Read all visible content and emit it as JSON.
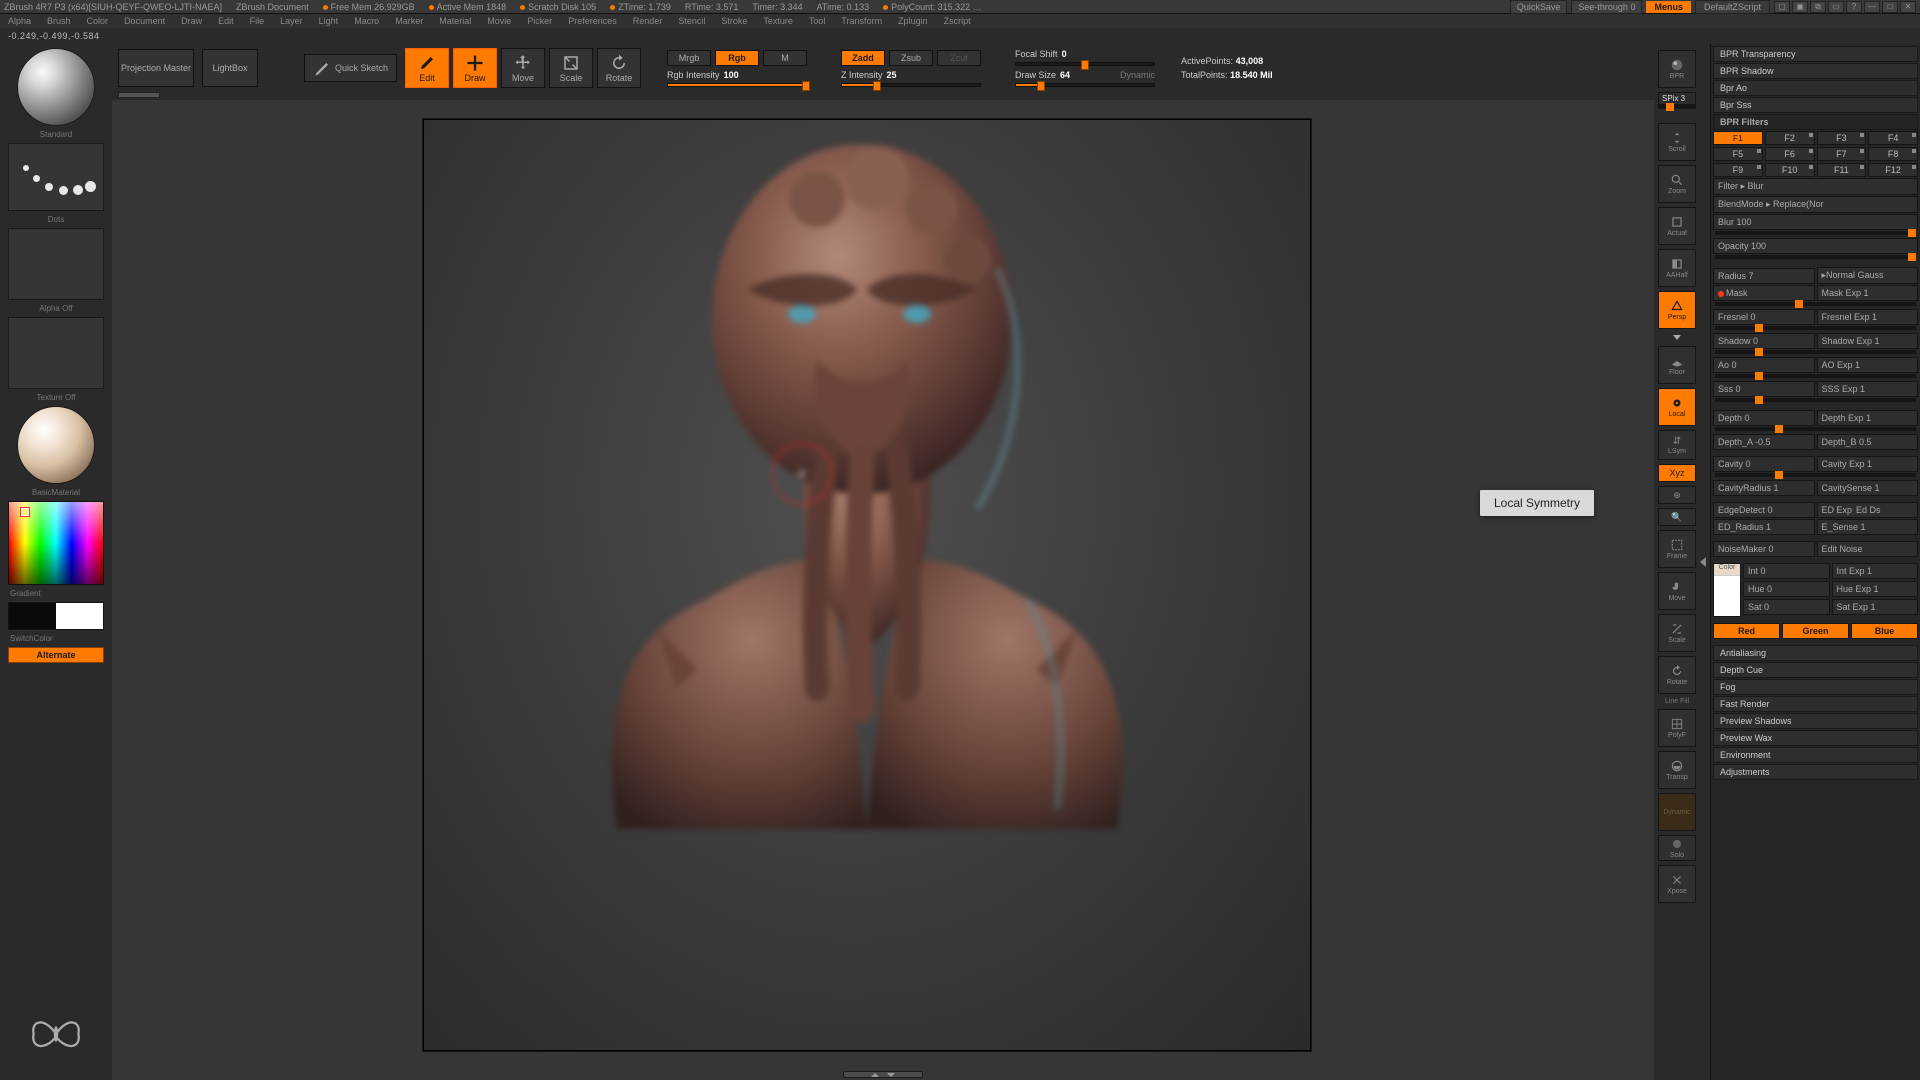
{
  "titlebar": {
    "app": "ZBrush 4R7 P3 (x64)[SIUH-QEYF-QWEO-LJTI-NAEA]",
    "doc": "ZBrush Document",
    "freemem": "Free Mem  26.929GB",
    "activemem": "Active Mem 1848",
    "scratch": "Scratch Disk 105",
    "ztime": "ZTime: 1.739",
    "rtime": "RTime: 3.571",
    "timer": "Timer: 3.344",
    "atime": "ATime: 0.133",
    "poly": "PolyCount: 315.322 …",
    "quicksave": "QuickSave",
    "seethrough": "See-through   0",
    "menus": "Menus",
    "defscript": "DefaultZScript"
  },
  "menus": [
    "Alpha",
    "Brush",
    "Color",
    "Document",
    "Draw",
    "Edit",
    "File",
    "Layer",
    "Light",
    "Macro",
    "Marker",
    "Material",
    "Movie",
    "Picker",
    "Preferences",
    "Render",
    "Stencil",
    "Stroke",
    "Texture",
    "Tool",
    "Transform",
    "Zplugin",
    "Zscript"
  ],
  "coord": "-0.249,-0.499,-0.584",
  "toolbar": {
    "projection": "Projection Master",
    "lightbox": "LightBox",
    "quicksketch": "Quick Sketch",
    "edit": "Edit",
    "draw": "Draw",
    "move": "Move",
    "scale": "Scale",
    "rotate": "Rotate",
    "mrgb": "Mrgb",
    "rgb": "Rgb",
    "m": "M",
    "rgbint_label": "Rgb Intensity",
    "rgbint_val": "100",
    "zadd": "Zadd",
    "zsub": "Zsub",
    "zcut": "Zcut",
    "zint_label": "Z Intensity",
    "zint_val": "25",
    "focal_label": "Focal Shift",
    "focal_val": "0",
    "drawsize_label": "Draw Size",
    "drawsize_val": "64",
    "dynamic": "Dynamic",
    "activepts_label": "ActivePoints:",
    "activepts_val": "43,008",
    "totalpts_label": "TotalPoints:",
    "totalpts_val": "18.540 Mil"
  },
  "left": {
    "standard": "Standard",
    "dots": "Dots",
    "alpha_off": "Alpha  Off",
    "texture_off": "Texture  Off",
    "basicmat": "BasicMaterial",
    "gradient": "Gradient",
    "switchcolor": "SwitchColor",
    "alternate": "Alternate"
  },
  "tooltip": "Local Symmetry",
  "side": {
    "bpr": "BPR",
    "spix": "SPix 3",
    "scroll": "Scroll",
    "zoom": "Zoom",
    "actual": "Actual",
    "aahalf": "AAHalf",
    "persp": "Persp",
    "floor": "Floor",
    "local": "Local",
    "lsym": "LSym",
    "xyz": "Xyz",
    "frame": "Frame",
    "move": "Move",
    "scale": "Scale",
    "rotate": "Rotate",
    "linefill": "Line Fill",
    "polyf": "PolyF",
    "transp": "Transp",
    "dynamic": "Dynamic",
    "solo": "Solo",
    "xpose": "Xpose"
  },
  "right": {
    "bpr_trans": "BPR Transparency",
    "bpr_shadow": "BPR Shadow",
    "bpr_ao": "Bpr Ao",
    "bpr_sss": "Bpr Sss",
    "bpr_filters": "BPR Filters",
    "filters": [
      "F1",
      "F2",
      "F3",
      "F4",
      "F5",
      "F6",
      "F7",
      "F8",
      "F9",
      "F10",
      "F11",
      "F12"
    ],
    "filter_sel": "Filter ▸ Blur",
    "blendmode": "BlendMode ▸ Replace(Nor",
    "blur": "Blur 100",
    "opacity": "Opacity 100",
    "radius": "Radius 7",
    "normal": "▸Normal  Gauss",
    "mask": "Mask",
    "maskexp": "Mask Exp 1",
    "fresnel": "Fresnel 0",
    "fresnelexp": "Fresnel Exp 1",
    "shadow": "Shadow 0",
    "shadowexp": "Shadow Exp 1",
    "ao": "Ao 0",
    "aoexp": "AO Exp 1",
    "sss": "Sss 0",
    "sssexp": "SSS Exp 1",
    "depth": "Depth 0",
    "depthexp": "Depth Exp 1",
    "deptha": "Depth_A -0.5",
    "depthb": "Depth_B 0.5",
    "cavity": "Cavity 0",
    "cavityexp": "Cavity Exp 1",
    "cavityrad": "CavityRadius 1",
    "cavitysense": "CavitySense 1",
    "edgedet": "EdgeDetect 0",
    "edexp": "ED Exp",
    "edds": "Ed Ds",
    "edrad": "ED_Radius 1",
    "esense": "E_Sense 1",
    "noisemaker": "NoiseMaker 0",
    "editnoise": "Edit Noise",
    "color": "Color",
    "int": "Int 0",
    "intexp": "Int Exp 1",
    "hue": "Hue 0",
    "hueexp": "Hue Exp 1",
    "sat": "Sat 0",
    "satexp": "Sat Exp 1",
    "red": "Red",
    "green": "Green",
    "blue": "Blue",
    "antialias": "Antialiasing",
    "depthcue": "Depth Cue",
    "fog": "Fog",
    "fastrender": "Fast Render",
    "prevshadows": "Preview Shadows",
    "prevwax": "Preview Wax",
    "env": "Environment",
    "adjust": "Adjustments"
  }
}
